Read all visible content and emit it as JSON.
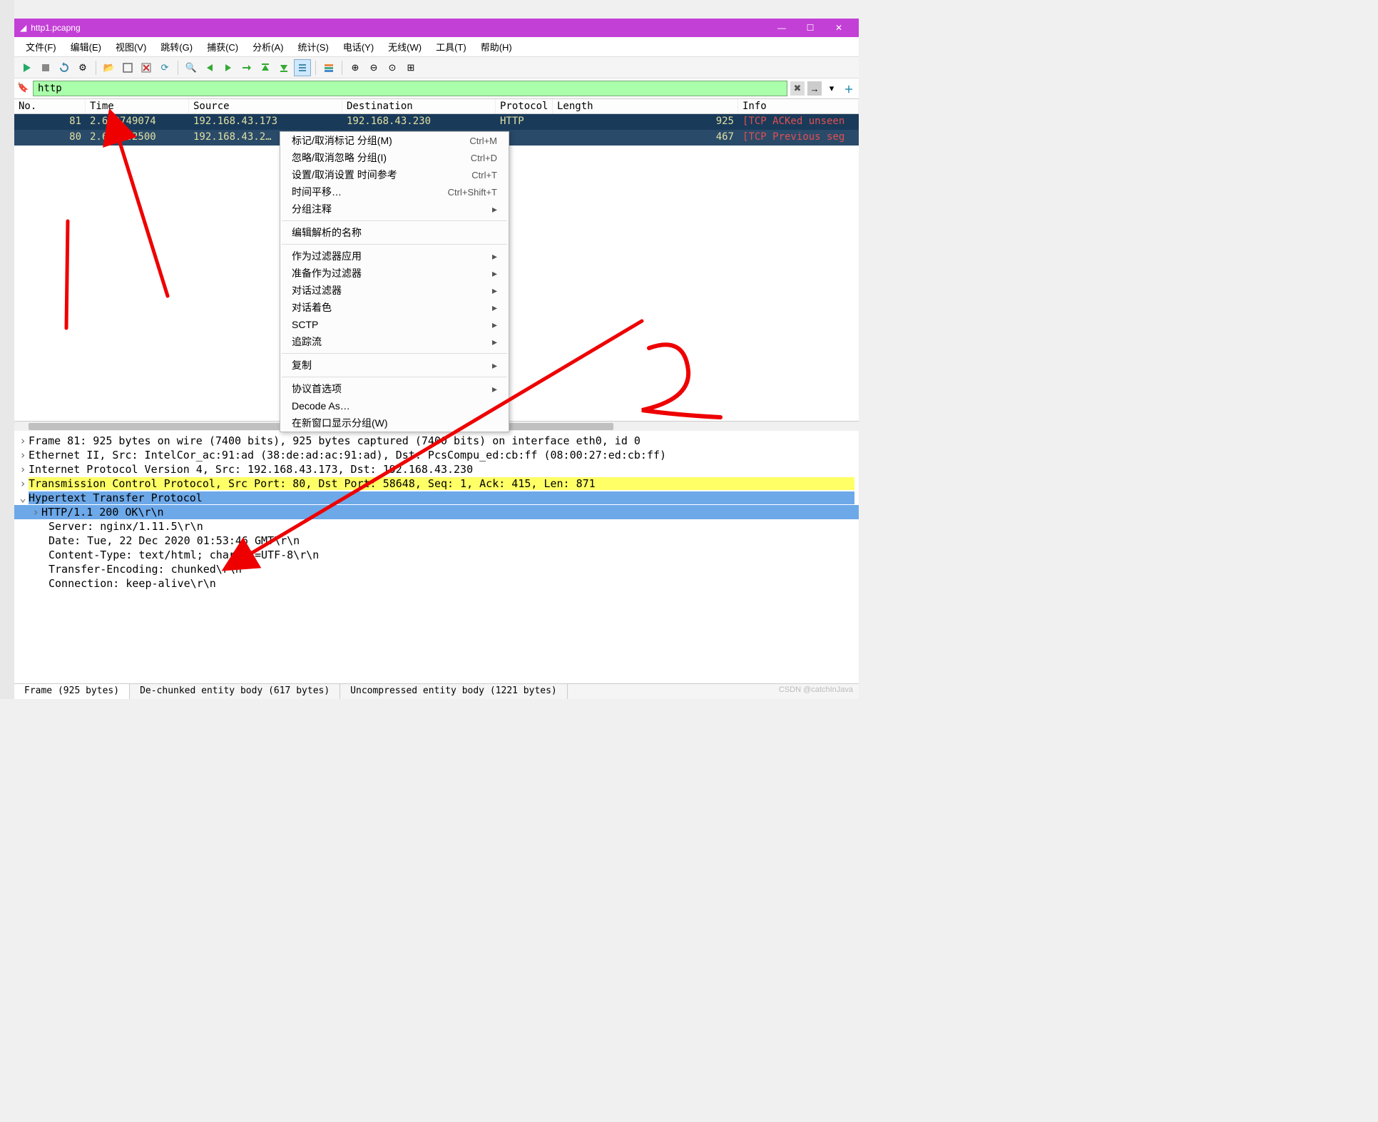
{
  "window": {
    "title": "http1.pcapng"
  },
  "menubar": [
    "文件(F)",
    "编辑(E)",
    "视图(V)",
    "跳转(G)",
    "捕获(C)",
    "分析(A)",
    "统计(S)",
    "电话(Y)",
    "无线(W)",
    "工具(T)",
    "帮助(H)"
  ],
  "filter": {
    "value": "http"
  },
  "columns": {
    "no": "No.",
    "time": "Time",
    "source": "Source",
    "dest": "Destination",
    "proto": "Protocol",
    "len": "Length",
    "info": "Info"
  },
  "packets": [
    {
      "no": "81",
      "time": "2.670749074",
      "src": "192.168.43.173",
      "dst": "192.168.43.230",
      "proto": "HTTP",
      "len": "925",
      "info": "[TCP ACKed unseen"
    },
    {
      "no": "80",
      "time": "2.631332500",
      "src": "192.168.43.2…",
      "dst": "",
      "proto": "",
      "len": "467",
      "info": "[TCP Previous seg"
    }
  ],
  "context_menu": [
    {
      "label": "标记/取消标记 分组(M)",
      "shortcut": "Ctrl+M"
    },
    {
      "label": "忽略/取消忽略 分组(I)",
      "shortcut": "Ctrl+D"
    },
    {
      "label": "设置/取消设置 时间参考",
      "shortcut": "Ctrl+T"
    },
    {
      "label": "时间平移…",
      "shortcut": "Ctrl+Shift+T"
    },
    {
      "label": "分组注释",
      "submenu": true
    },
    {
      "divider": true
    },
    {
      "label": "编辑解析的名称"
    },
    {
      "divider": true
    },
    {
      "label": "作为过滤器应用",
      "submenu": true
    },
    {
      "label": "准备作为过滤器",
      "submenu": true
    },
    {
      "label": "对话过滤器",
      "submenu": true
    },
    {
      "label": "对话着色",
      "submenu": true
    },
    {
      "label": "SCTP",
      "submenu": true
    },
    {
      "label": "追踪流",
      "submenu": true
    },
    {
      "divider": true
    },
    {
      "label": "复制",
      "submenu": true
    },
    {
      "divider": true
    },
    {
      "label": "协议首选项",
      "submenu": true
    },
    {
      "label": "Decode As…"
    },
    {
      "label": "在新窗口显示分组(W)"
    }
  ],
  "details": {
    "frame": "Frame 81: 925 bytes on wire (7400 bits), 925 bytes captured (7400 bits) on interface eth0, id 0",
    "eth": "Ethernet II, Src: IntelCor_ac:91:ad (38:de:ad:ac:91:ad), Dst: PcsCompu_ed:cb:ff (08:00:27:ed:cb:ff)",
    "ip": "Internet Protocol Version 4, Src: 192.168.43.173, Dst: 192.168.43.230",
    "tcp": "Transmission Control Protocol, Src Port: 80, Dst Port: 58648, Seq: 1, Ack: 415, Len: 871",
    "http": "Hypertext Transfer Protocol",
    "http_lines": [
      "HTTP/1.1 200 OK\\r\\n",
      "Server: nginx/1.11.5\\r\\n",
      "Date: Tue, 22 Dec 2020 01:53:46 GMT\\r\\n",
      "Content-Type: text/html; charset=UTF-8\\r\\n",
      "Transfer-Encoding: chunked\\r\\n",
      "Connection: keep-alive\\r\\n"
    ]
  },
  "tabs": {
    "frame": "Frame (925 bytes)",
    "dechunk": "De-chunked entity body (617 bytes)",
    "uncomp": "Uncompressed entity body (1221 bytes)"
  },
  "watermark": "CSDN @catchInJava",
  "icons": {
    "shark": "◢",
    "start": "▶",
    "stop": "■",
    "restart": "↻",
    "gear": "⚙",
    "folder": "📂",
    "save": "💾",
    "close": "✖",
    "reload": "⟳",
    "find": "🔍",
    "back": "←",
    "fwd": "→",
    "goto": "⇥",
    "top": "⤒",
    "bottom": "⤓",
    "autoscroll": "≡",
    "colorize": "≣",
    "zoomin": "⊕",
    "zoomout": "⊖",
    "zoom1": "⊙",
    "resize": "⊞",
    "bookmark": "🔖",
    "clear": "✖",
    "apply": "→",
    "dd": "▾",
    "plus": "＋",
    "min": "—",
    "max": "☐",
    "x": "✕"
  }
}
